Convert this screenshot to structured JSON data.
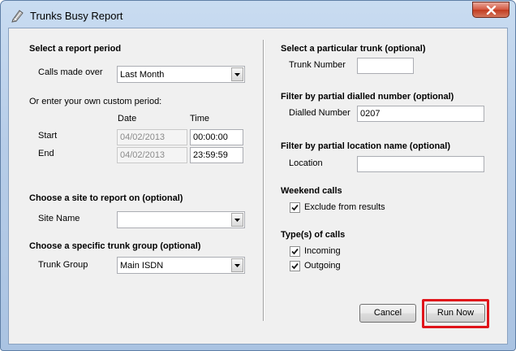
{
  "window": {
    "title": "Trunks Busy Report"
  },
  "left": {
    "report_period": {
      "heading": "Select a report period",
      "calls_made_over_label": "Calls made over",
      "calls_made_over_value": "Last Month",
      "custom_hint": "Or enter your own custom period:",
      "date_col": "Date",
      "time_col": "Time",
      "start_label": "Start",
      "start_date": "04/02/2013",
      "start_time": "00:00:00",
      "end_label": "End",
      "end_date": "04/02/2013",
      "end_time": "23:59:59"
    },
    "site": {
      "heading": "Choose a site to report on (optional)",
      "label": "Site Name",
      "value": ""
    },
    "trunk_group": {
      "heading": "Choose a specific trunk group (optional)",
      "label": "Trunk Group",
      "value": "Main ISDN"
    }
  },
  "right": {
    "trunk": {
      "heading": "Select a particular trunk (optional)",
      "label": "Trunk Number",
      "value": ""
    },
    "dialled": {
      "heading": "Filter by partial dialled number (optional)",
      "label": "Dialled Number",
      "value": "0207"
    },
    "location": {
      "heading": "Filter by partial location name (optional)",
      "label": "Location",
      "value": ""
    },
    "weekend": {
      "heading": "Weekend calls",
      "exclude_label": "Exclude from results",
      "exclude_checked": true
    },
    "call_types": {
      "heading": "Type(s) of calls",
      "incoming_label": "Incoming",
      "incoming_checked": true,
      "outgoing_label": "Outgoing",
      "outgoing_checked": true
    }
  },
  "buttons": {
    "cancel": "Cancel",
    "run_now": "Run Now"
  },
  "colors": {
    "highlight": "#e0151b",
    "close_button": "#c13b1f"
  }
}
